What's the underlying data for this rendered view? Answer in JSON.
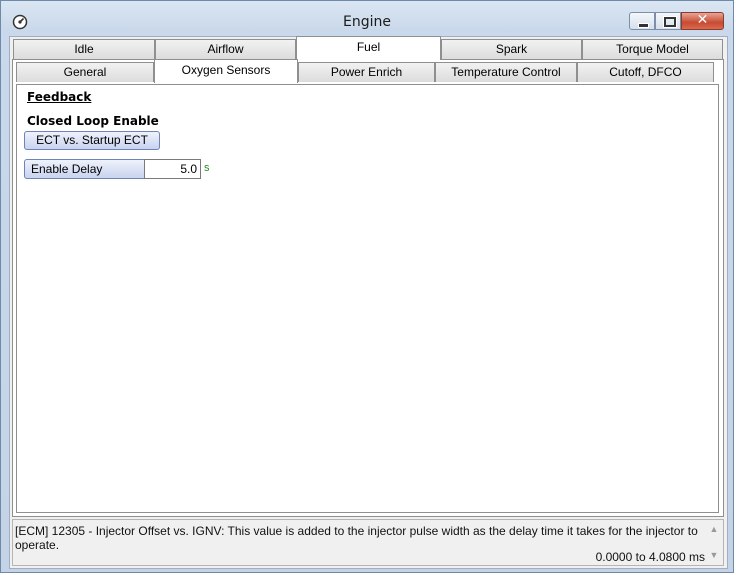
{
  "window": {
    "title": "Engine",
    "icon": "gauge-icon"
  },
  "controls": {
    "minimize": "minimize-icon",
    "maximize": "maximize-icon",
    "close_glyph": "✕"
  },
  "main_tabs": [
    "Idle",
    "Airflow",
    "Fuel",
    "Spark",
    "Torque Model"
  ],
  "main_tabs_active": "Fuel",
  "sub_tabs": [
    "General",
    "Oxygen Sensors",
    "Power Enrich",
    "Temperature Control",
    "Cutoff, DFCO"
  ],
  "sub_tabs_active": "Oxygen Sensors",
  "content": {
    "section": "Feedback",
    "group": "Closed Loop Enable",
    "table_button": "ECT vs. Startup ECT",
    "param": {
      "label": "Enable Delay",
      "value": "5.0",
      "unit": "s"
    }
  },
  "description": {
    "text": "[ECM] 12305 - Injector Offset vs. IGNV: This value is added to the injector pulse width as the delay time it takes for the injector to operate.",
    "range": "0.0000 to 4.0800 ms"
  },
  "colors": {
    "accent_button": "#c9d3ef",
    "unit_text": "#2b8a2b",
    "close_button": "#c74a32"
  }
}
